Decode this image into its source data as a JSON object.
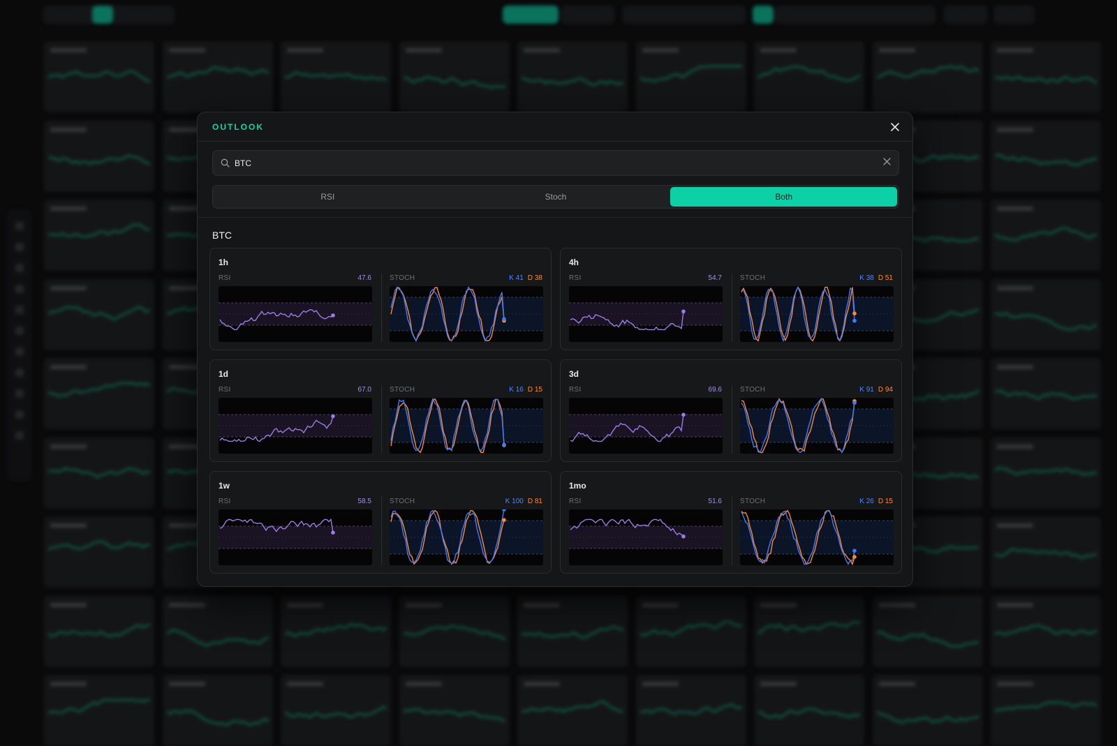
{
  "modal": {
    "title": "OUTLOOK",
    "search": {
      "value": "BTC",
      "placeholder": "Search symbol"
    },
    "tabs": [
      {
        "label": "RSI",
        "active": false
      },
      {
        "label": "Stoch",
        "active": false
      },
      {
        "label": "Both",
        "active": true
      }
    ],
    "symbol": "BTC",
    "rsi_label": "RSI",
    "stoch_label": "STOCH",
    "k_prefix": "K",
    "d_prefix": "D"
  },
  "timeframes": [
    {
      "label": "1h",
      "rsi": "47.6",
      "k": "41",
      "d": "38"
    },
    {
      "label": "4h",
      "rsi": "54.7",
      "k": "38",
      "d": "51"
    },
    {
      "label": "1d",
      "rsi": "67.0",
      "k": "16",
      "d": "15"
    },
    {
      "label": "3d",
      "rsi": "69.6",
      "k": "91",
      "d": "94"
    },
    {
      "label": "1w",
      "rsi": "58.5",
      "k": "100",
      "d": "81"
    },
    {
      "label": "1mo",
      "rsi": "51.6",
      "k": "26",
      "d": "15"
    }
  ],
  "colors": {
    "accent": "#0dd0a6",
    "rsi_line": "#9a7ee0",
    "k_line": "#3d7bff",
    "d_line": "#ff8a2a",
    "background_tile_line": "#14b68f"
  },
  "icons": {
    "close": "close-icon",
    "search": "search-icon",
    "clear": "clear-icon"
  }
}
